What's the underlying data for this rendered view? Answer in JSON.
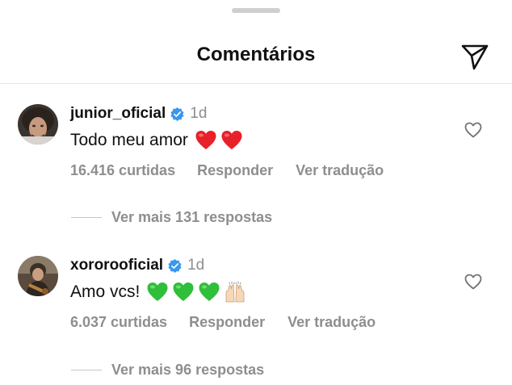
{
  "header": {
    "title": "Comentários",
    "share_icon": "paper-plane-icon"
  },
  "comments": [
    {
      "username": "junior_oficial",
      "verified": true,
      "time": "1d",
      "text": "Todo meu amor",
      "emojis": [
        "red-heart",
        "red-heart"
      ],
      "likes": "16.416 curtidas",
      "reply": "Responder",
      "translate": "Ver tradução",
      "more_replies": "Ver mais 131 respostas"
    },
    {
      "username": "xororooficial",
      "verified": true,
      "time": "1d",
      "text": "Amo vcs!",
      "emojis": [
        "green-heart",
        "green-heart",
        "green-heart",
        "raising-hands"
      ],
      "likes": "6.037 curtidas",
      "reply": "Responder",
      "translate": "Ver tradução",
      "more_replies": "Ver mais 96 respostas"
    }
  ],
  "colors": {
    "text": "#111111",
    "secondary": "#8e8e8e",
    "verified": "#3897f0",
    "red_heart": "#e8202a",
    "green_heart": "#2fbf3a"
  }
}
